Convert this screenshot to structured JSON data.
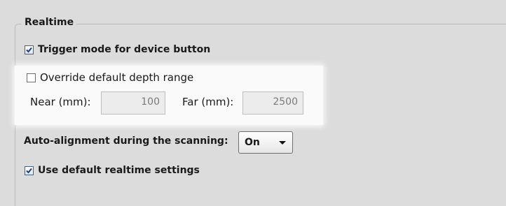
{
  "group": {
    "title": "Realtime"
  },
  "trigger": {
    "label": "Trigger mode for device button",
    "checked": true
  },
  "override": {
    "label": "Override default depth range",
    "checked": false
  },
  "near": {
    "label": "Near (mm):",
    "value": "100"
  },
  "far": {
    "label": "Far (mm):",
    "value": "2500"
  },
  "alignment": {
    "label": "Auto-alignment during the scanning:",
    "selected": "On"
  },
  "realtime_defaults": {
    "label": "Use default realtime settings",
    "checked": true
  }
}
